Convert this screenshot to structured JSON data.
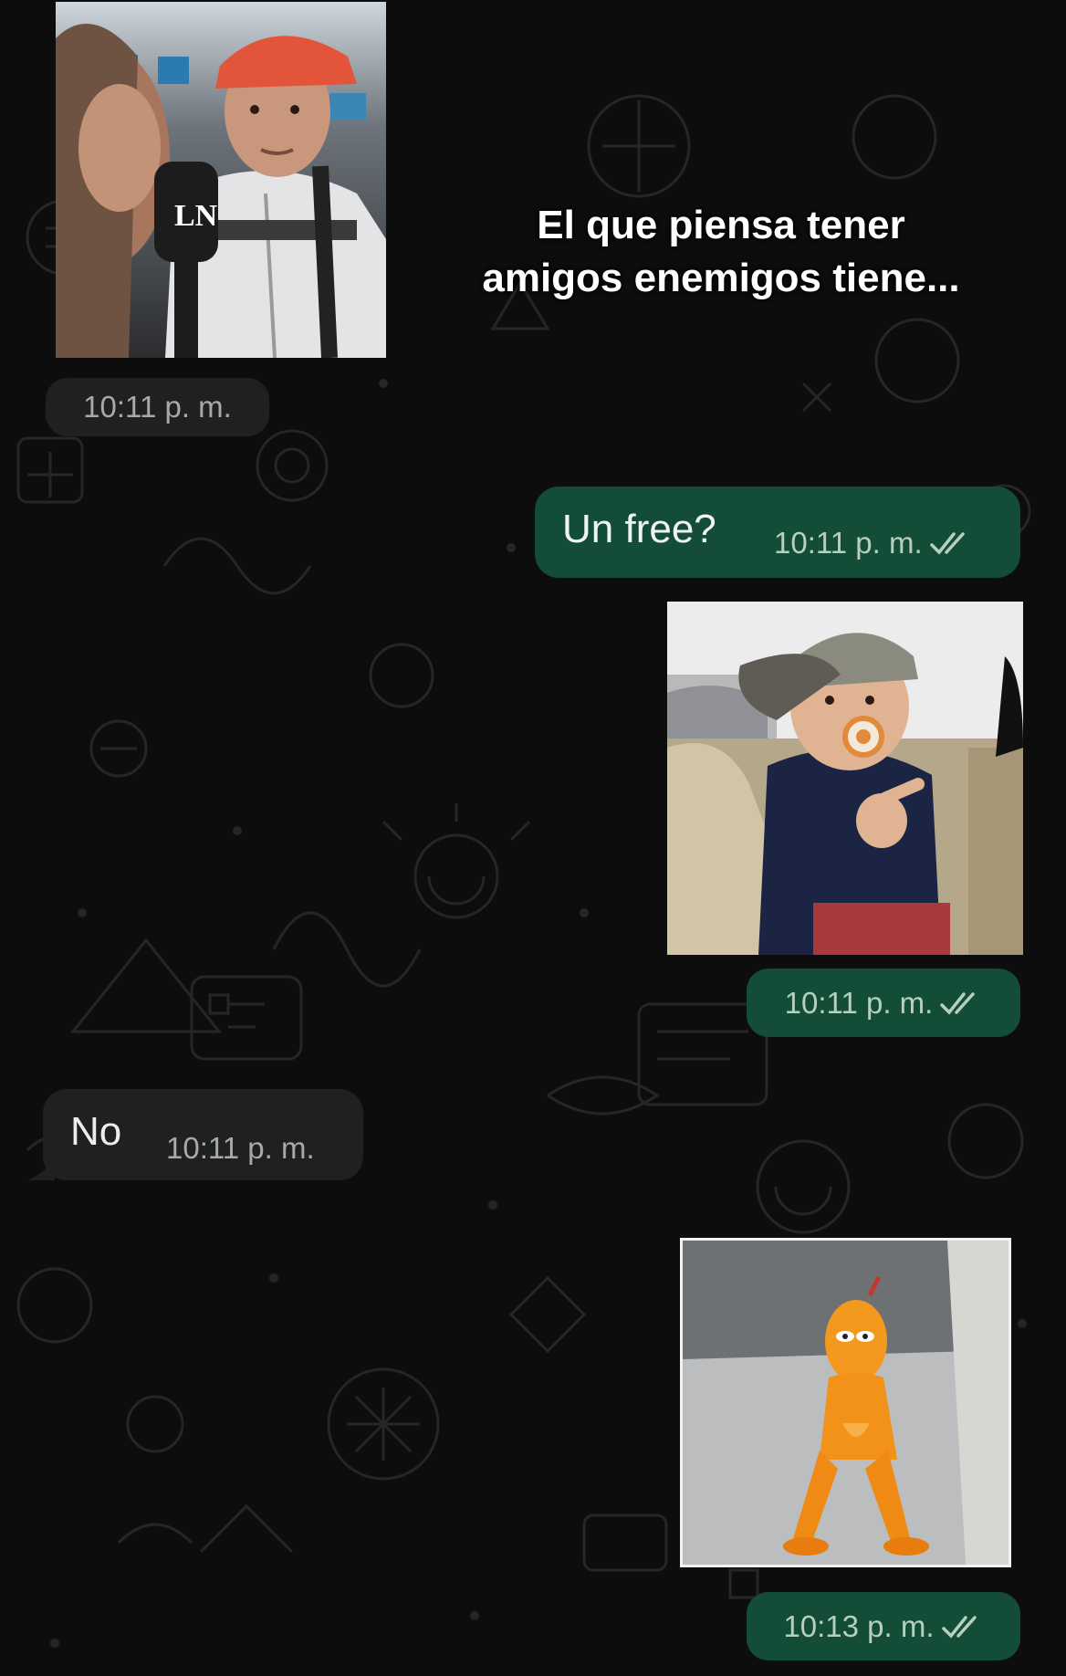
{
  "caption": {
    "line1": "El que piensa tener",
    "line2": "amigos enemigos tiene..."
  },
  "messages": [
    {
      "type": "image",
      "direction": "incoming",
      "subject": "young man in red cap and white hoodie being interviewed",
      "mic_label": "LN",
      "time": "10:11 p. m."
    },
    {
      "type": "text",
      "direction": "outgoing",
      "text": "Un free?",
      "time": "10:11 p. m.",
      "status_icon": "double-check-icon"
    },
    {
      "type": "image",
      "direction": "outgoing",
      "subject": "toddler with cap and pacifier giving thumbs up",
      "time": "10:11 p. m.",
      "status_icon": "double-check-icon"
    },
    {
      "type": "text",
      "direction": "incoming",
      "text": "No",
      "time": "10:11 p. m."
    },
    {
      "type": "sticker",
      "direction": "outgoing",
      "subject": "orange cartoon figure squatting",
      "time": "10:13 p. m.",
      "status_icon": "double-check-icon"
    }
  ],
  "colors": {
    "background": "#0d0d0d",
    "outgoing_bubble": "#144d37",
    "incoming_bubble": "#1f2021"
  }
}
